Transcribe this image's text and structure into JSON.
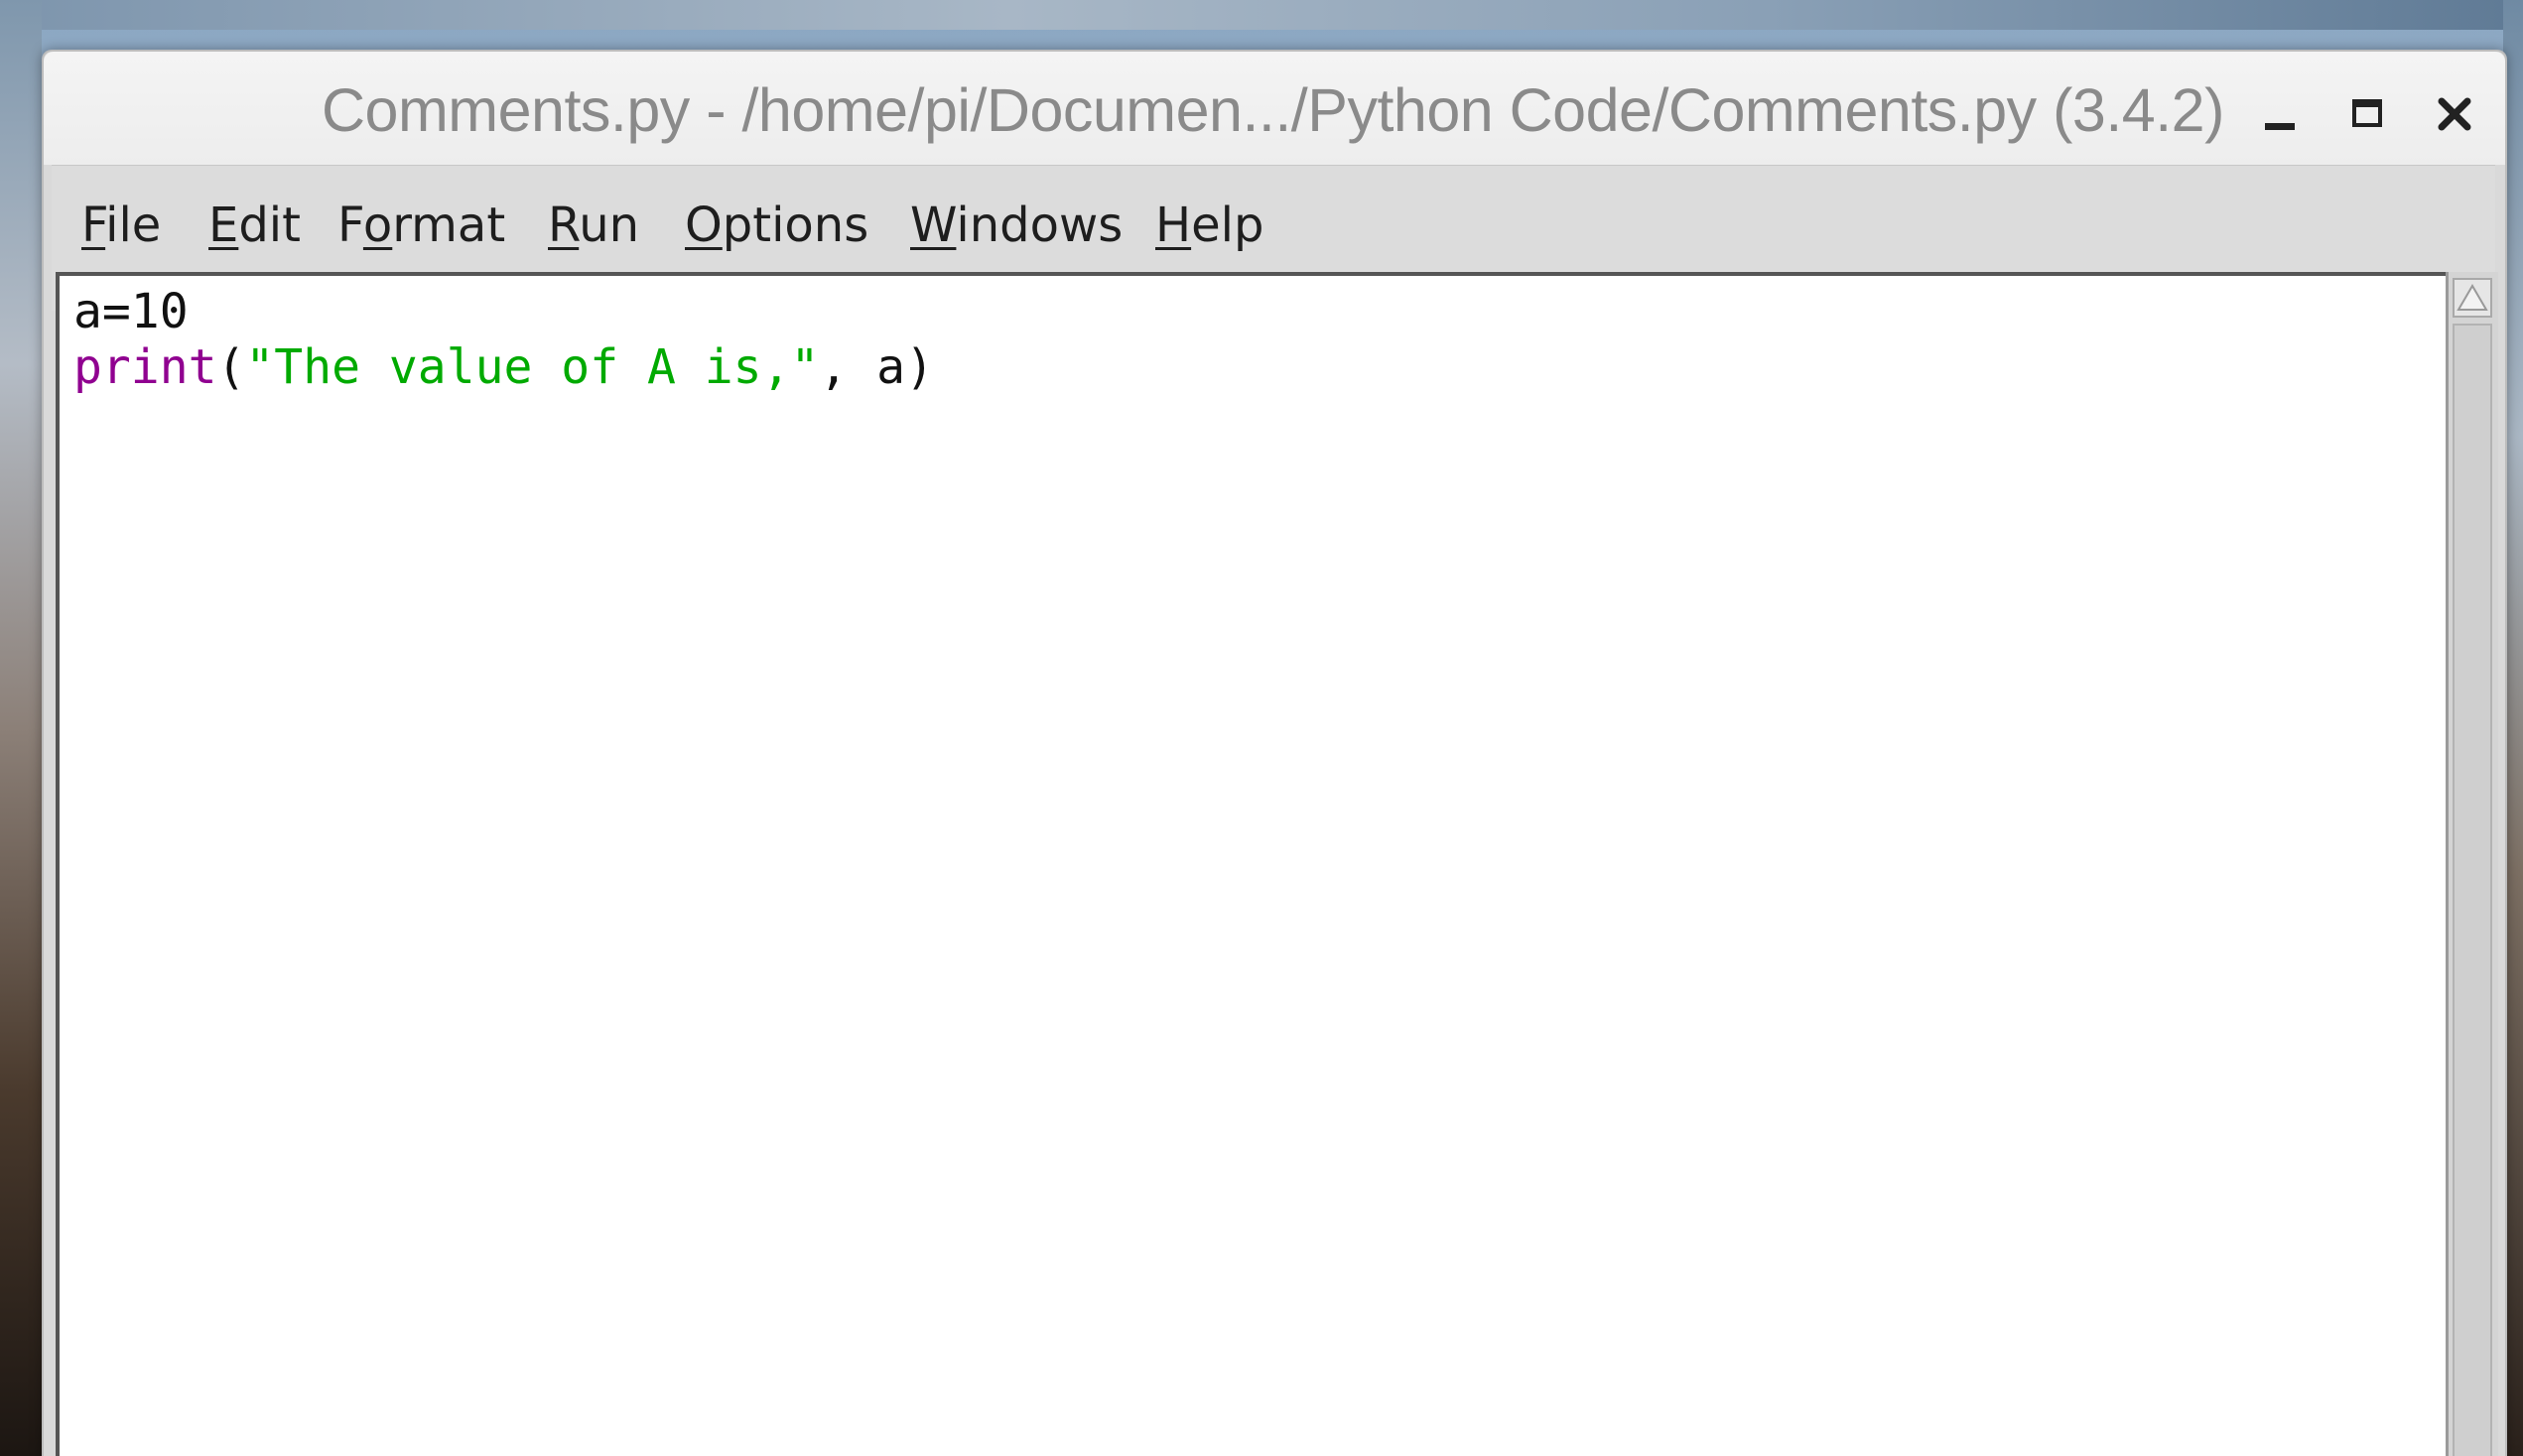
{
  "window": {
    "title": "Comments.py - /home/pi/Documen.../Python Code/Comments.py (3.4.2)",
    "controls": {
      "minimize_icon": "minimize-icon",
      "maximize_icon": "maximize-icon",
      "close_icon": "close-icon"
    }
  },
  "menu": {
    "items": [
      {
        "mnemonic": "F",
        "rest": "ile"
      },
      {
        "mnemonic": "E",
        "rest": "dit"
      },
      {
        "pre": "F",
        "mnemonic": "o",
        "rest": "rmat"
      },
      {
        "mnemonic": "R",
        "rest": "un"
      },
      {
        "mnemonic": "O",
        "rest": "ptions"
      },
      {
        "mnemonic": "W",
        "rest": "indows"
      },
      {
        "mnemonic": "H",
        "rest": "elp"
      }
    ]
  },
  "editor": {
    "lines": [
      {
        "text": "a=10"
      },
      {
        "builtin": "print",
        "open": "(",
        "string": "\"The value of A is,\"",
        "rest": ", a)"
      }
    ]
  },
  "colors": {
    "builtin": "#900090",
    "string": "#00aa00",
    "text": "#111111"
  }
}
